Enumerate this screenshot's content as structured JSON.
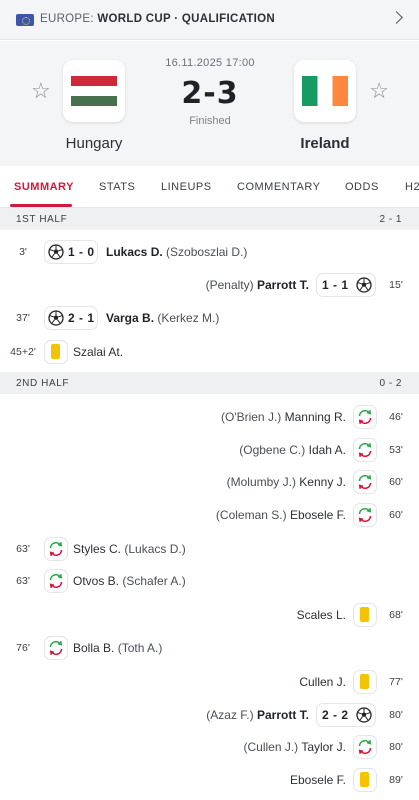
{
  "competition": {
    "region": "EUROPE:",
    "name": "WORLD CUP · QUALIFICATION",
    "flag_icon": "eu-flag-icon"
  },
  "match": {
    "date": "16.11.2025 17:00",
    "score": "2-3",
    "status": "Finished",
    "home_team": "Hungary",
    "away_team": "Ireland"
  },
  "tabs": [
    {
      "label": "SUMMARY",
      "active": true
    },
    {
      "label": "STATS"
    },
    {
      "label": "LINEUPS"
    },
    {
      "label": "COMMENTARY"
    },
    {
      "label": "ODDS"
    },
    {
      "label": "H2"
    }
  ],
  "first_half": {
    "title": "1ST HALF",
    "score": "2 - 1",
    "events": [
      {
        "minute": "3'",
        "side": "home",
        "type": "goal",
        "score": "1 - 0",
        "player": "Lukacs D.",
        "assist": "(Szoboszlai D.)"
      },
      {
        "minute": "15'",
        "side": "away",
        "type": "goal",
        "score": "1 - 1",
        "player": "Parrott T.",
        "assist": "(Penalty)"
      },
      {
        "minute": "37'",
        "side": "home",
        "type": "goal",
        "score": "2 - 1",
        "player": "Varga B.",
        "assist": "(Kerkez M.)"
      },
      {
        "minute": "45+2'",
        "side": "home",
        "type": "yellow-card",
        "player": "Szalai At."
      }
    ]
  },
  "second_half": {
    "title": "2ND HALF",
    "score": "0 - 2",
    "events": [
      {
        "minute": "46'",
        "side": "away",
        "type": "substitution",
        "player": "Manning R.",
        "assist": "(O'Brien J.)"
      },
      {
        "minute": "53'",
        "side": "away",
        "type": "substitution",
        "player": "Idah A.",
        "assist": "(Ogbene C.)"
      },
      {
        "minute": "60'",
        "side": "away",
        "type": "substitution",
        "player": "Kenny J.",
        "assist": "(Molumby J.)"
      },
      {
        "minute": "60'",
        "side": "away",
        "type": "substitution",
        "player": "Ebosele F.",
        "assist": "(Coleman S.)"
      },
      {
        "minute": "63'",
        "side": "home",
        "type": "substitution",
        "player": "Styles C.",
        "assist": "(Lukacs D.)"
      },
      {
        "minute": "63'",
        "side": "home",
        "type": "substitution",
        "player": "Otvos B.",
        "assist": "(Schafer A.)"
      },
      {
        "minute": "68'",
        "side": "away",
        "type": "yellow-card",
        "player": "Scales L."
      },
      {
        "minute": "76'",
        "side": "home",
        "type": "substitution",
        "player": "Bolla B.",
        "assist": "(Toth A.)"
      },
      {
        "minute": "77'",
        "side": "away",
        "type": "yellow-card",
        "player": "Cullen J."
      },
      {
        "minute": "80'",
        "side": "away",
        "type": "goal",
        "score": "2 - 2",
        "player": "Parrott T.",
        "assist": "(Azaz F.)"
      },
      {
        "minute": "80'",
        "side": "away",
        "type": "substitution",
        "player": "Taylor J.",
        "assist": "(Cullen J.)"
      },
      {
        "minute": "89'",
        "side": "away",
        "type": "yellow-card",
        "player": "Ebosele F."
      }
    ]
  },
  "colors": {
    "accent": "#d1183d",
    "yellow_card": "#f5c400",
    "sub_in": "#2fa84f",
    "sub_out": "#d1183d",
    "section_bg": "#eef0f2"
  }
}
